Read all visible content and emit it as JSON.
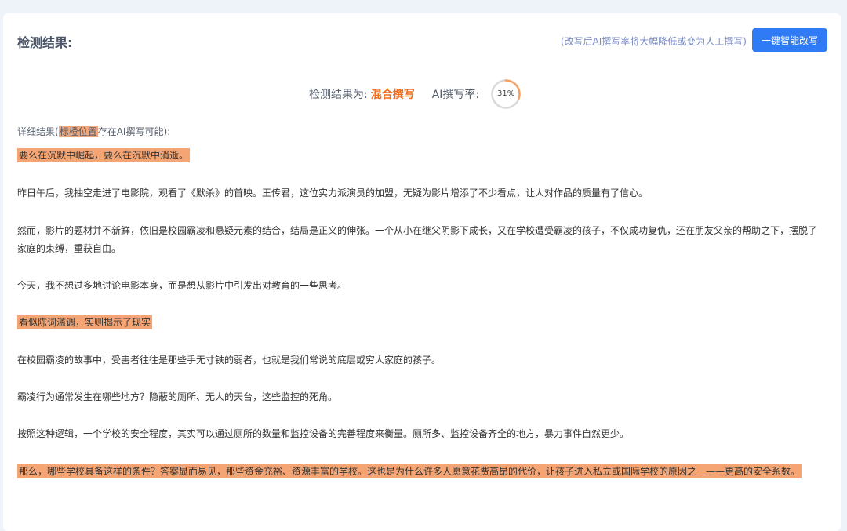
{
  "header": {
    "title": "检测结果:",
    "hint": "(改写后AI撰写率将大幅降低或变为人工撰写)",
    "rewrite_button": "一键智能改写"
  },
  "summary": {
    "label": "检测结果为:",
    "result": "混合撰写",
    "rate_label": "AI撰写率:",
    "rate_text": "31%",
    "rate_value": 31,
    "colors": {
      "result": "#f26b1d",
      "ring_progress": "#f5a065",
      "ring_track": "#d9d9d9"
    }
  },
  "detail": {
    "prefix": "详细结果(",
    "mark": "标橙位置",
    "suffix": "存在AI撰写可能):"
  },
  "paragraphs": [
    {
      "text": "要么在沉默中崛起，要么在沉默中消逝。",
      "highlighted": true
    },
    {
      "text": "昨日午后，我抽空走进了电影院，观看了《默杀》的首映。王传君，这位实力派演员的加盟，无疑为影片增添了不少看点，让人对作品的质量有了信心。",
      "highlighted": false
    },
    {
      "text": "然而，影片的题材并不新鲜，依旧是校园霸凌和悬疑元素的结合，结局是正义的伸张。一个从小在继父阴影下成长，又在学校遭受霸凌的孩子，不仅成功复仇，还在朋友父亲的帮助之下，摆脱了家庭的束缚，重获自由。",
      "highlighted": false
    },
    {
      "text": "今天，我不想过多地讨论电影本身，而是想从影片中引发出对教育的一些思考。",
      "highlighted": false
    },
    {
      "text": "看似陈词滥调，实则揭示了现实",
      "highlighted": true
    },
    {
      "text": "在校园霸凌的故事中，受害者往往是那些手无寸铁的弱者，也就是我们常说的底层或穷人家庭的孩子。",
      "highlighted": false
    },
    {
      "text": "霸凌行为通常发生在哪些地方？隐蔽的厕所、无人的天台，这些监控的死角。",
      "highlighted": false
    },
    {
      "text": "按照这种逻辑，一个学校的安全程度，其实可以通过厕所的数量和监控设备的完善程度来衡量。厕所多、监控设备齐全的地方，暴力事件自然更少。",
      "highlighted": false
    },
    {
      "text": "那么，哪些学校具备这样的条件？答案显而易见，那些资金充裕、资源丰富的学校。这也是为什么许多人愿意花费高昂的代价，让孩子进入私立或国际学校的原因之一——更高的安全系数。",
      "highlighted": true
    }
  ]
}
